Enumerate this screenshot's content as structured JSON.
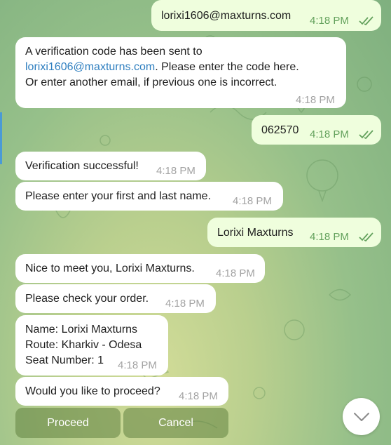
{
  "chat": {
    "msg1": {
      "text": "lorixi1606@maxturns.com",
      "time": "4:18 PM"
    },
    "msg2": {
      "line1": "A verification code has been sent to",
      "link": "lorixi1606@maxturns.com",
      "line2_rest": ". Please enter the code here.",
      "line3": "Or enter another email, if previous one is incorrect.",
      "time": "4:18 PM"
    },
    "msg3": {
      "text": "062570",
      "time": "4:18 PM"
    },
    "msg4": {
      "text": "Verification successful!",
      "time": "4:18 PM"
    },
    "msg5": {
      "text": "Please enter your first and last name.",
      "time": "4:18 PM"
    },
    "msg6": {
      "text": "Lorixi Maxturns",
      "time": "4:18 PM"
    },
    "msg7": {
      "text": "Nice to meet you, Lorixi Maxturns.",
      "time": "4:18 PM"
    },
    "msg8": {
      "text": "Please check your order.",
      "time": "4:18 PM"
    },
    "msg9": {
      "line1": "Name: Lorixi Maxturns",
      "line2": "Route: Kharkiv - Odesa",
      "line3": "Seat Number: 1",
      "time": "4:18 PM"
    },
    "msg10": {
      "text": "Would you like to proceed?",
      "time": "4:18 PM"
    }
  },
  "keyboard": {
    "proceed_label": "Proceed",
    "cancel_label": "Cancel"
  },
  "icons": {
    "read_receipt": "double-check-icon",
    "scroll_down": "chevron-down-icon"
  },
  "colors": {
    "incoming_bubble": "#ffffff",
    "outgoing_bubble": "#effedd",
    "link": "#2f7fc0",
    "outgoing_time": "#63a15c"
  }
}
